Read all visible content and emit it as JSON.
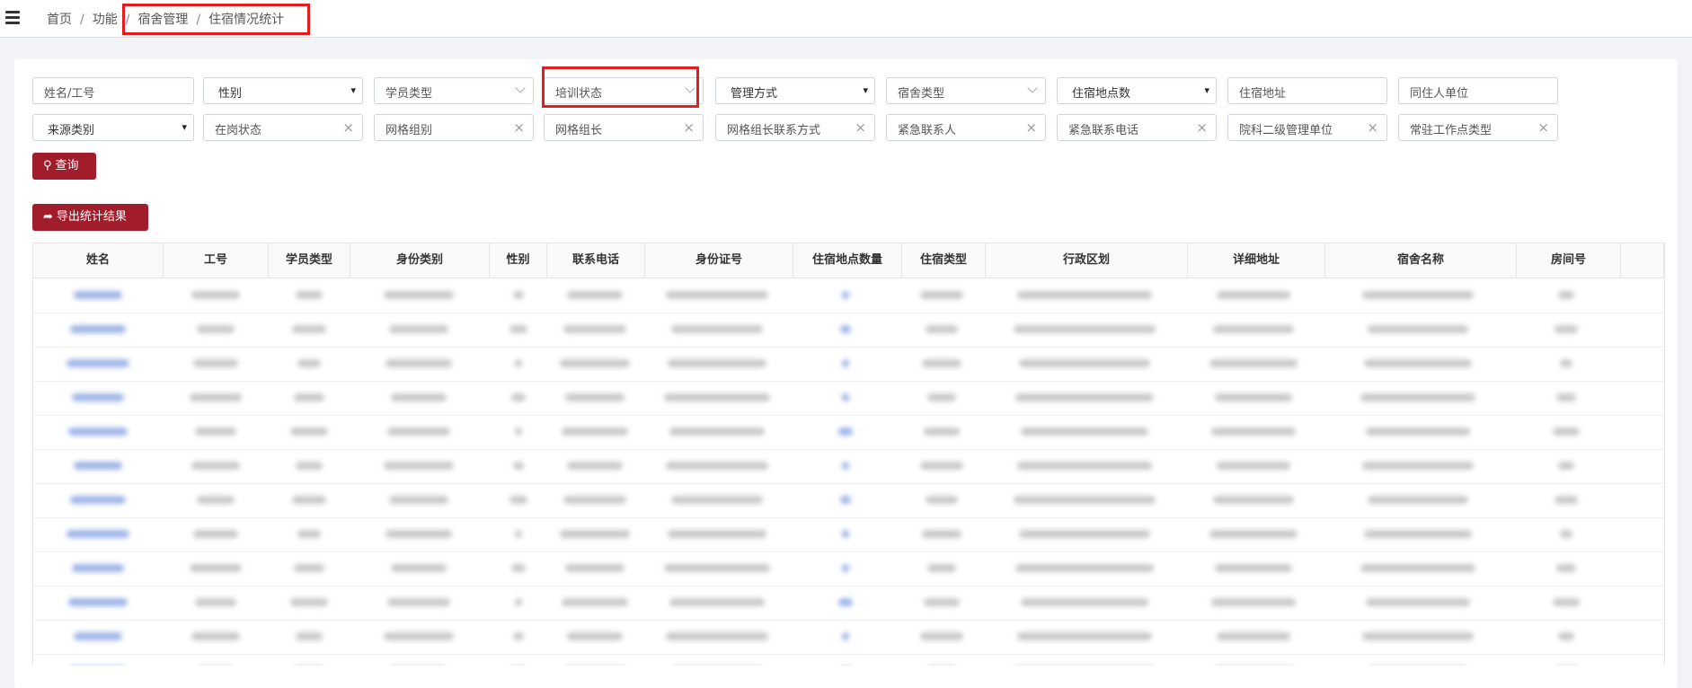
{
  "breadcrumb": {
    "home": "首页",
    "func": "功能",
    "dorm": "宿舍管理",
    "stats": "住宿情况统计",
    "sep": "/"
  },
  "filters": {
    "row1": [
      {
        "label": "姓名/工号",
        "kind": "input"
      },
      {
        "label": "性别",
        "kind": "select"
      },
      {
        "label": "学员类型",
        "kind": "combo"
      },
      {
        "label": "培训状态",
        "kind": "combo"
      },
      {
        "label": "管理方式",
        "kind": "select"
      },
      {
        "label": "宿舍类型",
        "kind": "combo"
      },
      {
        "label": "住宿地点数",
        "kind": "select"
      },
      {
        "label": "住宿地址",
        "kind": "input"
      },
      {
        "label": "同住人单位",
        "kind": "input"
      }
    ],
    "row2": [
      {
        "label": "来源类别",
        "kind": "select"
      },
      {
        "label": "在岗状态",
        "kind": "clear"
      },
      {
        "label": "网格组别",
        "kind": "clear"
      },
      {
        "label": "网格组长",
        "kind": "clear"
      },
      {
        "label": "网格组长联系方式",
        "kind": "clear"
      },
      {
        "label": "紧急联系人",
        "kind": "clear"
      },
      {
        "label": "紧急联系电话",
        "kind": "clear"
      },
      {
        "label": "院科二级管理单位",
        "kind": "clear"
      },
      {
        "label": "常驻工作点类型",
        "kind": "clear"
      }
    ]
  },
  "buttons": {
    "query": "查询",
    "export": "导出统计结果"
  },
  "table": {
    "headers": [
      "姓名",
      "工号",
      "学员类型",
      "身份类别",
      "性别",
      "联系电话",
      "身份证号",
      "住宿地点数量",
      "住宿类型",
      "行政区划",
      "详细地址",
      "宿舍名称",
      "房间号"
    ]
  },
  "icons": {
    "menu": "menu-icon",
    "search": "search-icon",
    "export": "share-icon"
  },
  "colors": {
    "accent": "#a11d2b",
    "highlight": "#e31d1d",
    "link_blur": "#9fb5e8"
  }
}
